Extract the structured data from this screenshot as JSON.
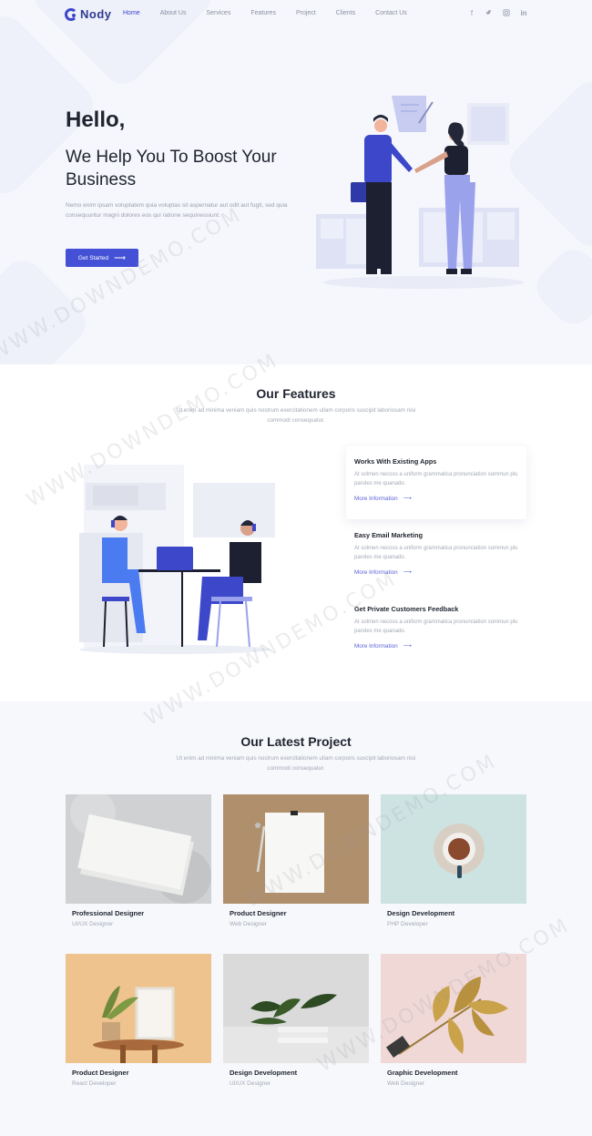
{
  "nav": {
    "logo": "Nody",
    "items": [
      "Home",
      "About Us",
      "Services",
      "Features",
      "Project",
      "Clients",
      "Contact Us"
    ],
    "active": "Home",
    "socials": [
      {
        "name": "facebook-icon",
        "glyph": "f"
      },
      {
        "name": "twitter-icon",
        "glyph": "t"
      },
      {
        "name": "instagram-icon",
        "glyph": "◎"
      },
      {
        "name": "linkedin-icon",
        "glyph": "in"
      }
    ]
  },
  "hero": {
    "greeting": "Hello,",
    "headline": "We Help You To Boost Your Business",
    "text": "Nemo enim ipsam voluptatem quia voluptas sit aspernatur aut odit aut fugit, sed quia consequuntur magni dolores eos qui ratione sequinessiunt.",
    "button_label": "Get Started"
  },
  "features": {
    "title": "Our Features",
    "subtitle": "Ut enim ad minima veniam quis nostrum exercitationem ullam corporis suscipit laboriosam nisi commodi consequatur.",
    "items": [
      {
        "title": "Works With Existing Apps",
        "text": "At solmen necoso a uniform grammatica pronunciation sommun plu paroles me quanado.",
        "link": "More Information"
      },
      {
        "title": "Easy Email Marketing",
        "text": "At solmen necoso a uniform grammatica pronunciation sommun plu paroles me quanado.",
        "link": "More Information"
      },
      {
        "title": "Get Private Customers Feedback",
        "text": "At solmen necoso a uniform grammatica pronunciation sommun plu paroles me quanado.",
        "link": "More Information"
      }
    ]
  },
  "projects": {
    "title": "Our Latest Project",
    "subtitle": "Ut enim ad minima veniam quis nostrum exercitationem ullam corporis suscipit laboriosam nisi commodi consequatur.",
    "items": [
      {
        "title": "Professional Designer",
        "role": "UI/UX Designer"
      },
      {
        "title": "Product Designer",
        "role": "Web Designer"
      },
      {
        "title": "Design Development",
        "role": "PHP Developer"
      },
      {
        "title": "Product Designer",
        "role": "React Developer"
      },
      {
        "title": "Design Development",
        "role": "UI/UX Designer"
      },
      {
        "title": "Graphic Development",
        "role": "Web Designer"
      }
    ]
  },
  "watermark": "WWW.DOWNDEMO.COM",
  "colors": {
    "accent": "#4450d6",
    "heading": "#1f2430",
    "muted": "#a3a8b6"
  }
}
